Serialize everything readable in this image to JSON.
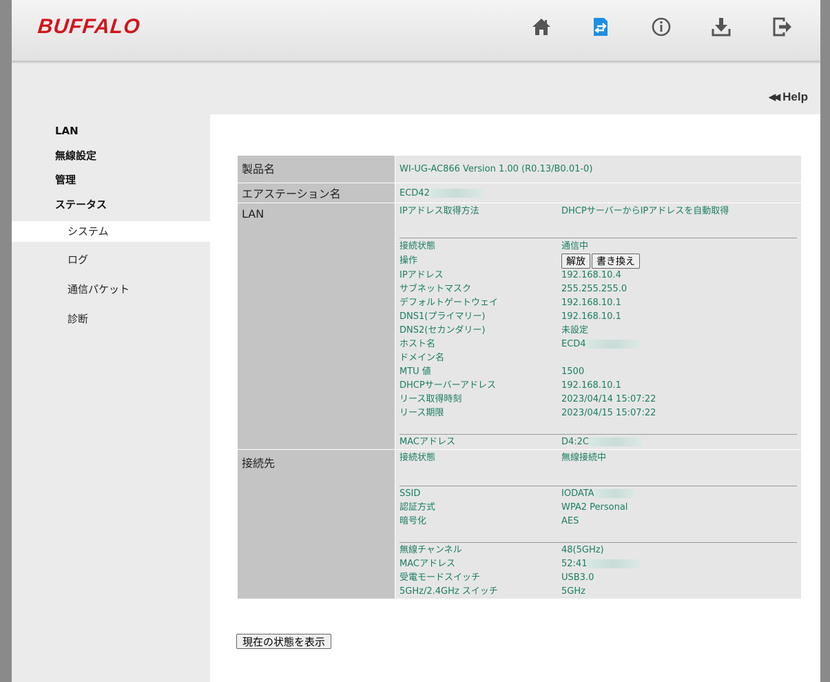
{
  "brand": {
    "logo_text": "BUFFALO",
    "accent": "#d0161d",
    "active_icon_color": "#1e8fe6"
  },
  "header": {
    "icons": [
      "home-icon",
      "status-icon",
      "info-icon",
      "download-icon",
      "logout-icon"
    ]
  },
  "help": {
    "label": "Help"
  },
  "sidebar": {
    "items": [
      {
        "label": "LAN"
      },
      {
        "label": "無線設定"
      },
      {
        "label": "管理"
      },
      {
        "label": "ステータス"
      }
    ],
    "sub_items": [
      {
        "label": "システム",
        "active": true
      },
      {
        "label": "ログ"
      },
      {
        "label": "通信パケット"
      },
      {
        "label": "診断"
      }
    ]
  },
  "status": {
    "product": {
      "label": "製品名",
      "value": "WI-UG-AC866 Version 1.00 (R0.13/B0.01-0)"
    },
    "airstation": {
      "label": "エアステーション名",
      "value": "ECD42"
    },
    "lan": {
      "label": "LAN",
      "ip_method": {
        "key": "IPアドレス取得方法",
        "value": "DHCPサーバーからIPアドレスを自動取得"
      },
      "conn_state": {
        "key": "接続状態",
        "value": "通信中"
      },
      "operation": {
        "key": "操作",
        "release_label": "解放",
        "renew_label": "書き換え"
      },
      "rows": [
        {
          "key": "IPアドレス",
          "value": "192.168.10.4"
        },
        {
          "key": "サブネットマスク",
          "value": "255.255.255.0"
        },
        {
          "key": "デフォルトゲートウェイ",
          "value": "192.168.10.1"
        },
        {
          "key": "DNS1(プライマリー)",
          "value": "192.168.10.1"
        },
        {
          "key": "DNS2(セカンダリー)",
          "value": "未設定"
        },
        {
          "key": "ホスト名",
          "value": "ECD4"
        },
        {
          "key": "ドメイン名",
          "value": ""
        },
        {
          "key": "MTU 値",
          "value": "1500"
        },
        {
          "key": "DHCPサーバーアドレス",
          "value": "192.168.10.1"
        },
        {
          "key": "リース取得時刻",
          "value": "2023/04/14 15:07:22"
        },
        {
          "key": "リース期限",
          "value": "2023/04/15 15:07:22"
        }
      ],
      "mac": {
        "key": "MACアドレス",
        "value": "D4:2C"
      }
    },
    "dest": {
      "label": "接続先",
      "conn_state": {
        "key": "接続状態",
        "value": "無線接続中"
      },
      "ssid": {
        "key": "SSID",
        "value": "IODATA"
      },
      "auth": {
        "key": "認証方式",
        "value": "WPA2 Personal"
      },
      "enc": {
        "key": "暗号化",
        "value": "AES"
      },
      "channel": {
        "key": "無線チャンネル",
        "value": "48(5GHz)"
      },
      "mac": {
        "key": "MACアドレス",
        "value": "52:41"
      },
      "power_mode": {
        "key": "受電モードスイッチ",
        "value": "USB3.0"
      },
      "band_switch": {
        "key": "5GHz/2.4GHz スイッチ",
        "value": "5GHz"
      }
    }
  },
  "refresh_button": {
    "label": "現在の状態を表示"
  }
}
